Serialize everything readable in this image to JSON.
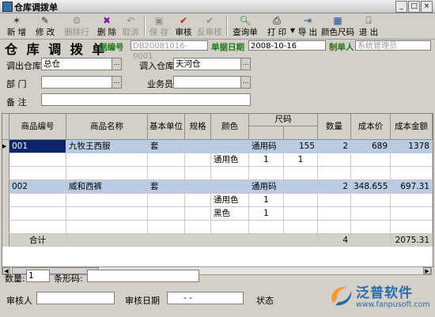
{
  "window": {
    "title": "仓库调拨单"
  },
  "toolbar": {
    "new": "新 增",
    "edit": "修 改",
    "delete_row": "删除行",
    "delete": "删 除",
    "cancel": "取消",
    "save": "保 存",
    "approve": "审核",
    "unapprove": "反审核",
    "query": "查询单",
    "print": "打 印",
    "export": "导 出",
    "color_size": "颜色尺码",
    "exit": "退 出"
  },
  "header": {
    "heading": "仓 库 调 拨 单",
    "doc_no_label": "据编号",
    "doc_no": "DB20081016-0001",
    "date_label": "单据日期",
    "date": "2008-10-16",
    "maker_label": "制单人",
    "maker": "系统管理员"
  },
  "form": {
    "out_wh_label": "调出仓库",
    "out_wh": "总仓",
    "in_wh_label": "调入仓库",
    "in_wh": "天河仓",
    "dept_label": "部    门",
    "dept": "",
    "sales_label": "业务员",
    "sales": "",
    "remark_label": "备    注",
    "remark": ""
  },
  "grid": {
    "headers": {
      "code": "商品编号",
      "name": "商品名称",
      "unit": "基本单位",
      "spec": "规格",
      "color": "颜色",
      "size": "尺码",
      "qty": "数量",
      "cost": "成本价",
      "amount": "成本金额"
    },
    "rows": [
      {
        "code": "001",
        "name": "九牧王西服",
        "unit": "套",
        "spec": "",
        "color": "",
        "s1": "通用码",
        "s2": "155",
        "qty": "2",
        "cost": "689",
        "amount": "1378"
      },
      {
        "code": "",
        "name": "",
        "unit": "",
        "spec": "",
        "color": "通用色",
        "s1": "1",
        "s2": "1",
        "qty": "",
        "cost": "",
        "amount": ""
      },
      {
        "code": "",
        "name": "",
        "unit": "",
        "spec": "",
        "color": "",
        "s1": "",
        "s2": "",
        "qty": "",
        "cost": "",
        "amount": ""
      },
      {
        "code": "002",
        "name": "威和西裤",
        "unit": "套",
        "spec": "",
        "color": "",
        "s1": "通用码",
        "s2": "",
        "qty": "2",
        "cost": "348.655",
        "amount": "697.31"
      },
      {
        "code": "",
        "name": "",
        "unit": "",
        "spec": "",
        "color": "通用色",
        "s1": "1",
        "s2": "",
        "qty": "",
        "cost": "",
        "amount": ""
      },
      {
        "code": "",
        "name": "",
        "unit": "",
        "spec": "",
        "color": "黑色",
        "s1": "1",
        "s2": "",
        "qty": "",
        "cost": "",
        "amount": ""
      },
      {
        "code": "",
        "name": "",
        "unit": "",
        "spec": "",
        "color": "",
        "s1": "",
        "s2": "",
        "qty": "",
        "cost": "",
        "amount": ""
      }
    ],
    "total": {
      "label": "合计",
      "qty": "4",
      "amount": "2075.31"
    }
  },
  "bottom": {
    "qty_label": "数量:",
    "qty": "1",
    "barcode_label": "条形码:",
    "barcode": "",
    "approver_label": "审核人",
    "approver": "",
    "approve_date_label": "审核日期",
    "approve_date": "-   -",
    "status_label": "状态"
  },
  "logo": {
    "name": "泛普软件",
    "url": "www.fanpusoft.com"
  }
}
